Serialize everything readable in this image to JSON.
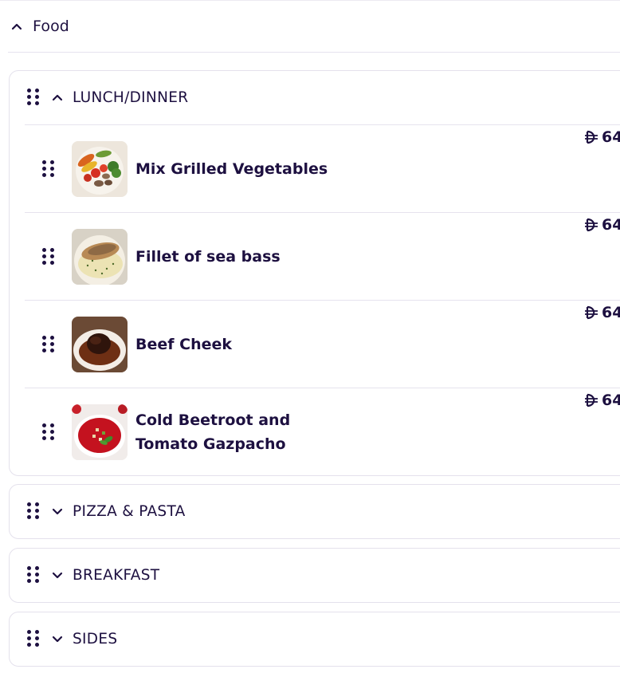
{
  "food": {
    "title": "Food",
    "expanded": true
  },
  "sections": [
    {
      "title": "LUNCH/DINNER",
      "expanded": true,
      "items": [
        {
          "name": "Mix Grilled Vegetables",
          "price": "64",
          "thumbnail": "grilled-vegetables"
        },
        {
          "name": "Fillet of sea bass",
          "price": "64",
          "thumbnail": "sea-bass"
        },
        {
          "name": "Beef Cheek",
          "price": "64",
          "thumbnail": "beef-cheek"
        },
        {
          "name_line1": "Cold Beetroot and",
          "name_line2": "Tomato Gazpacho",
          "price": "64",
          "thumbnail": "beetroot-gazpacho"
        }
      ]
    },
    {
      "title": "PIZZA & PASTA",
      "expanded": false
    },
    {
      "title": "BREAKFAST",
      "expanded": false
    },
    {
      "title": "SIDES",
      "expanded": false
    }
  ],
  "icons": {
    "drag": "drag-handle-icon",
    "expand": "chevron-up-icon",
    "collapse": "chevron-down-icon",
    "currency": "dirham-icon"
  },
  "colors": {
    "text": "#1d1040",
    "border": "#e4e1ec"
  }
}
